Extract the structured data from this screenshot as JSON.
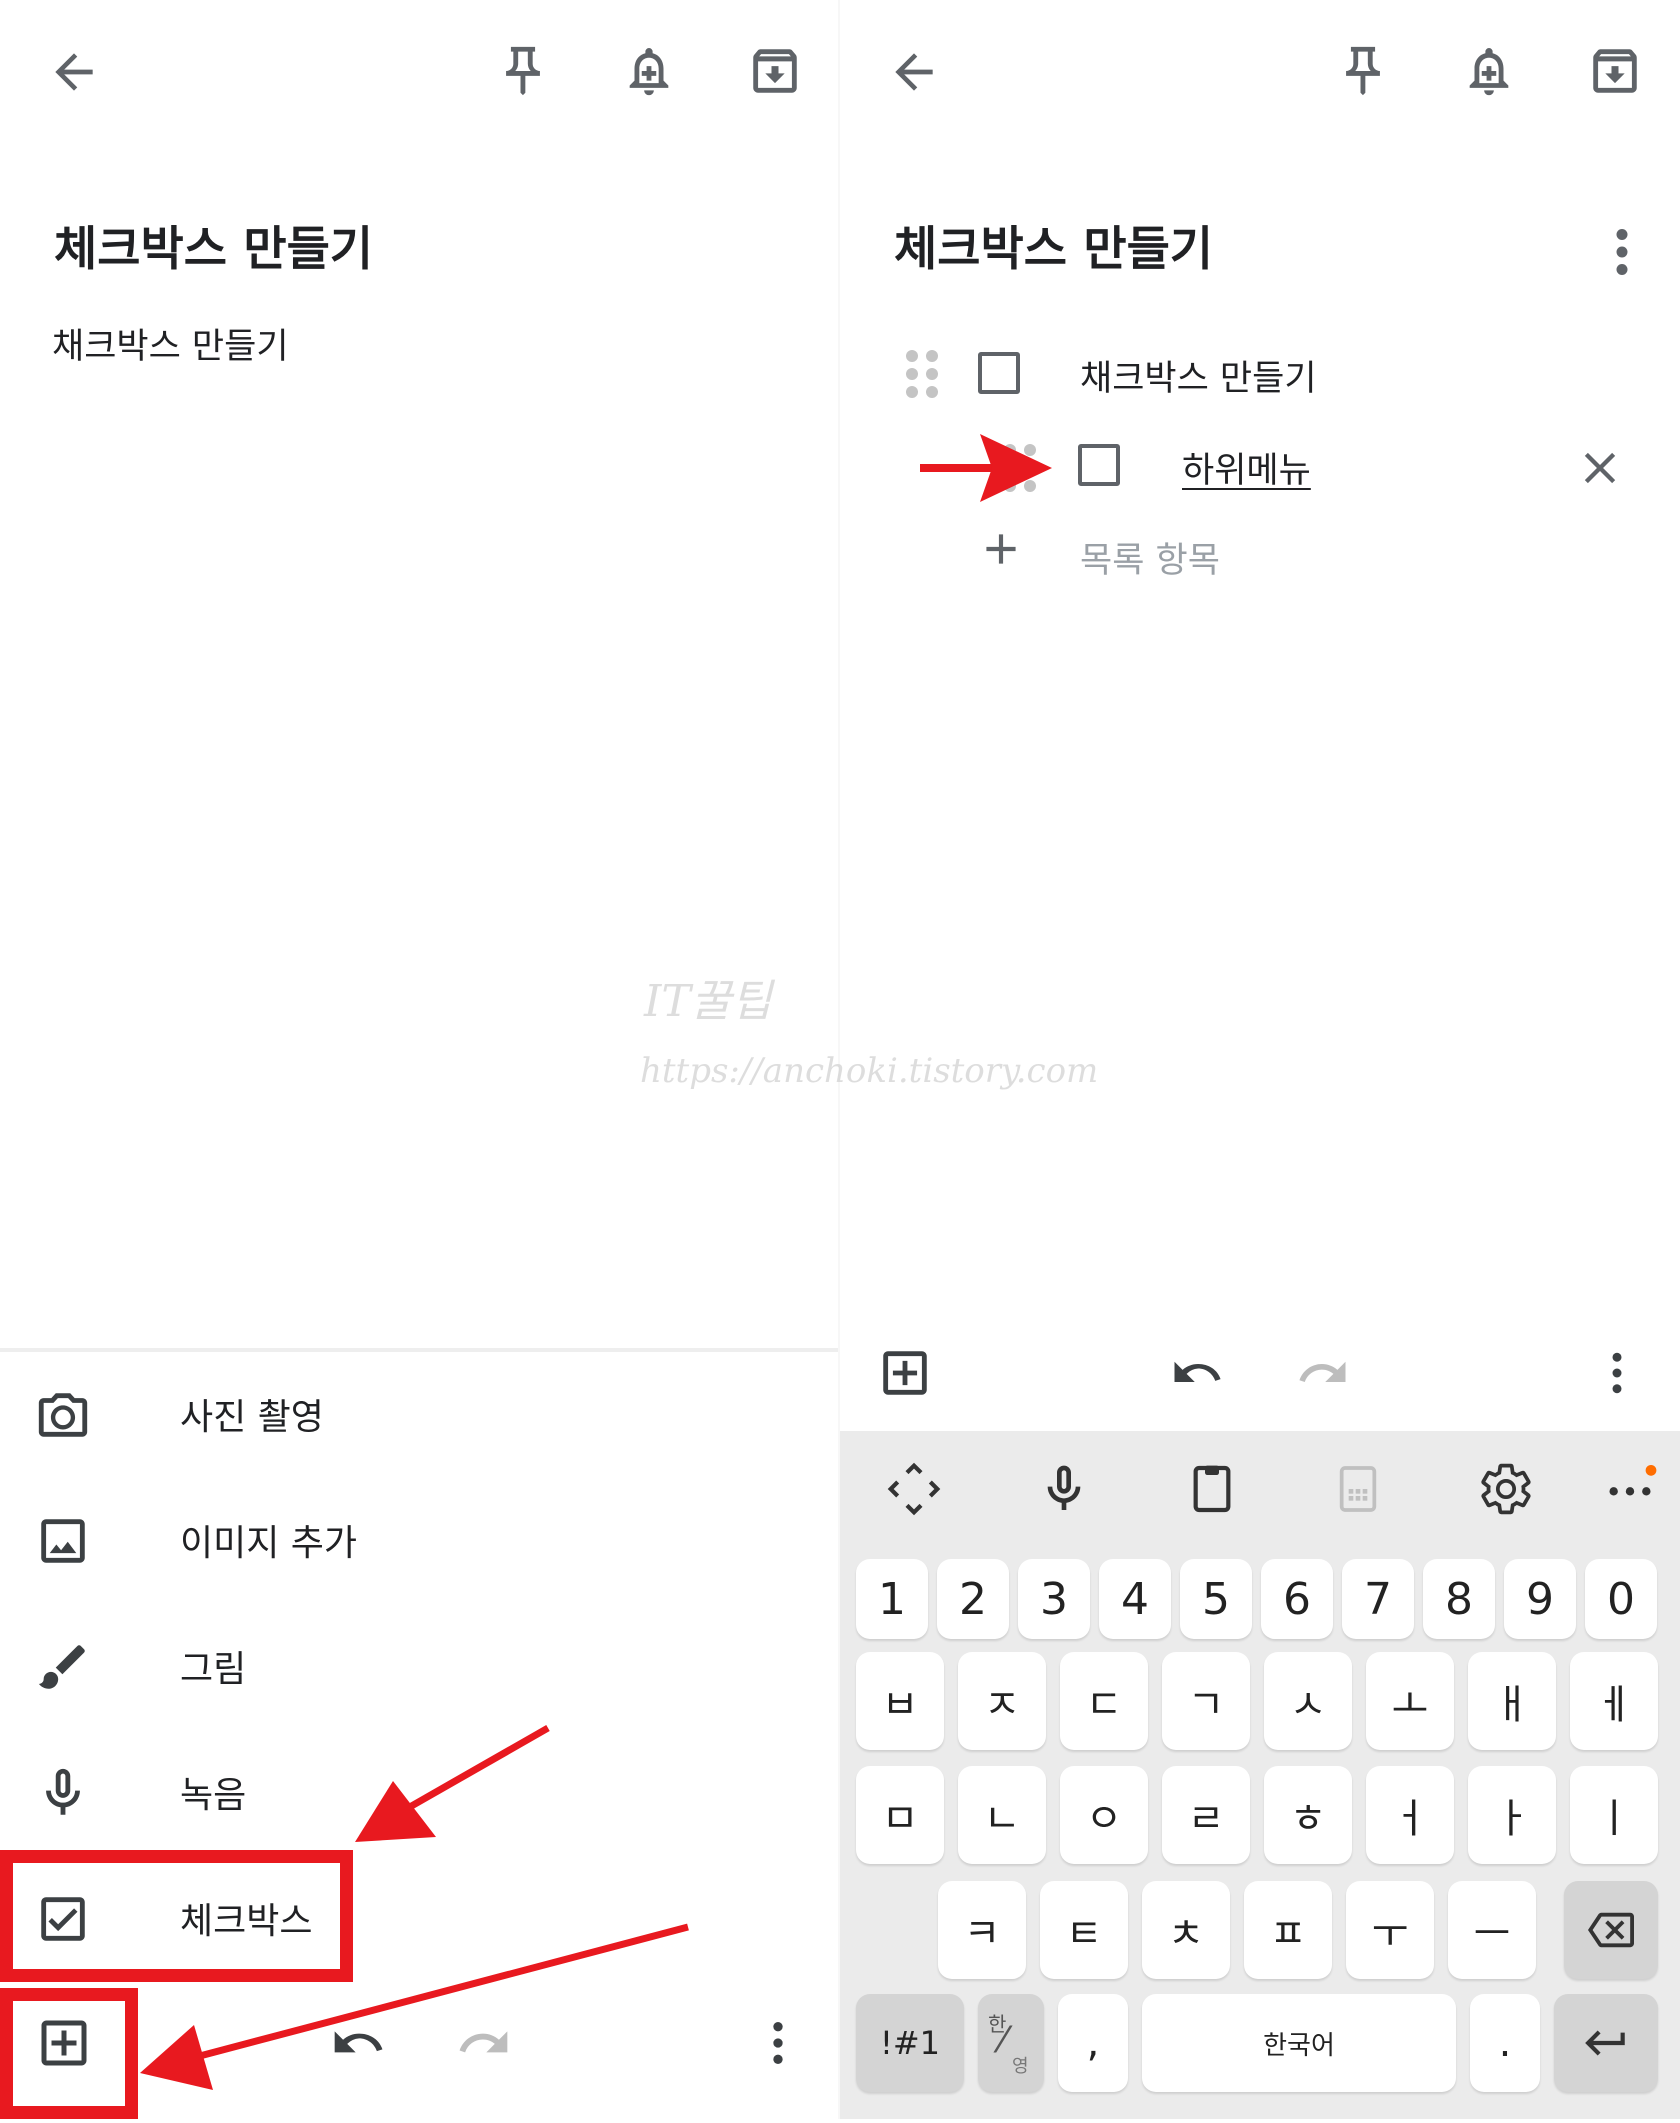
{
  "left_screen": {
    "note_title": "체크박스 만들기",
    "note_body": "채크박스 만들기",
    "menu_items": [
      {
        "label": "사진 촬영",
        "icon": "camera-icon"
      },
      {
        "label": "이미지 추가",
        "icon": "image-icon"
      },
      {
        "label": "그림",
        "icon": "brush-icon"
      },
      {
        "label": "녹음",
        "icon": "mic-icon"
      },
      {
        "label": "체크박스",
        "icon": "checkbox-icon"
      }
    ]
  },
  "right_screen": {
    "note_title": "체크박스 만들기",
    "checklist": [
      {
        "text": "채크박스 만들기",
        "checked": false
      },
      {
        "text": "하위메뉴",
        "checked": false
      }
    ],
    "add_item_placeholder": "목록 항목"
  },
  "keyboard": {
    "number_row": [
      "1",
      "2",
      "3",
      "4",
      "5",
      "6",
      "7",
      "8",
      "9",
      "0"
    ],
    "row1": [
      "ㅂ",
      "ㅈ",
      "ㄷ",
      "ㄱ",
      "ㅅ",
      "ㅗ",
      "ㅐ",
      "ㅔ"
    ],
    "row2": [
      "ㅁ",
      "ㄴ",
      "ㅇ",
      "ㄹ",
      "ㅎ",
      "ㅓ",
      "ㅏ",
      "ㅣ"
    ],
    "row3": [
      "ㅋ",
      "ㅌ",
      "ㅊ",
      "ㅍ",
      "ㅜ",
      "ㅡ"
    ],
    "symbols_key": "!#1",
    "lang_switch_top": "한",
    "lang_switch_bottom": "영",
    "comma_key": ",",
    "space_key": "한국어",
    "period_key": "."
  },
  "watermark": {
    "line1": "IT꿀팁",
    "line2": "https://anchoki.tistory.com"
  },
  "colors": {
    "annotation_red": "#e8191f",
    "icon_gray": "#5f6368",
    "keyboard_bg": "#ebebeb",
    "notification_dot": "#ff6d00"
  }
}
